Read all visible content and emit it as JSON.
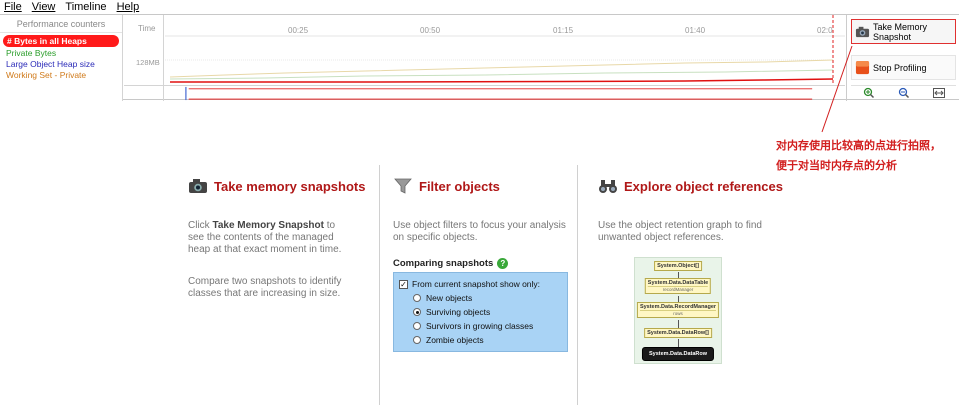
{
  "menu": [
    "File",
    "View",
    "Timeline",
    "Help"
  ],
  "counters": {
    "header": "Performance counters",
    "items": [
      {
        "label": "# Bytes in all Heaps",
        "style": "sel"
      },
      {
        "label": "Private Bytes",
        "style": "green"
      },
      {
        "label": "Large Object Heap size",
        "style": "blue"
      },
      {
        "label": "Working Set - Private",
        "style": "orange"
      }
    ]
  },
  "timeline": {
    "time_label": "Time",
    "ticks": [
      "00:25",
      "00:50",
      "01:15",
      "01:40",
      "02:0"
    ],
    "y_marker": "128MB"
  },
  "buttons": {
    "snapshot": "Take Memory Snapshot",
    "stop": "Stop Profiling"
  },
  "annotation": [
    "对内存使用比较高的点进行拍照，",
    "便于对当时内存点的分析"
  ],
  "panels": {
    "snapshots": {
      "title": "Take memory snapshots",
      "desc_pre": "Click ",
      "desc_bold": "Take Memory Snapshot",
      "desc_post": " to see the contents of the managed heap at that exact moment in time.",
      "desc2": "Compare two snapshots to identify classes that are increasing in size."
    },
    "filter": {
      "title": "Filter objects",
      "desc": "Use object filters to focus your analysis on specific objects.",
      "comparing_title": "Comparing snapshots",
      "checkbox_label": "From current snapshot show only:",
      "options": [
        {
          "label": "New objects",
          "selected": false
        },
        {
          "label": "Surviving objects",
          "selected": true
        },
        {
          "label": "Survivors in growing classes",
          "selected": false
        },
        {
          "label": "Zombie objects",
          "selected": false
        }
      ]
    },
    "explore": {
      "title": "Explore object references",
      "desc": "Use the object retention graph to find unwanted object references.",
      "graph_nodes": [
        {
          "label": "System.Object[]",
          "sub": ""
        },
        {
          "label": "System.Data.DataTable",
          "sub": "recordManager"
        },
        {
          "label": "System.Data.RecordManager",
          "sub": "rows"
        },
        {
          "label": "System.Data.DataRow[]",
          "sub": ""
        },
        {
          "label": "System.Data.DataRow",
          "sub": ""
        }
      ]
    }
  },
  "colors": {
    "accent_red": "#b01818",
    "selected_counter": "#ff1a1a",
    "private_bytes": "#2a9d2a",
    "loh": "#2a2ab8",
    "working_set": "#d07a1a"
  }
}
